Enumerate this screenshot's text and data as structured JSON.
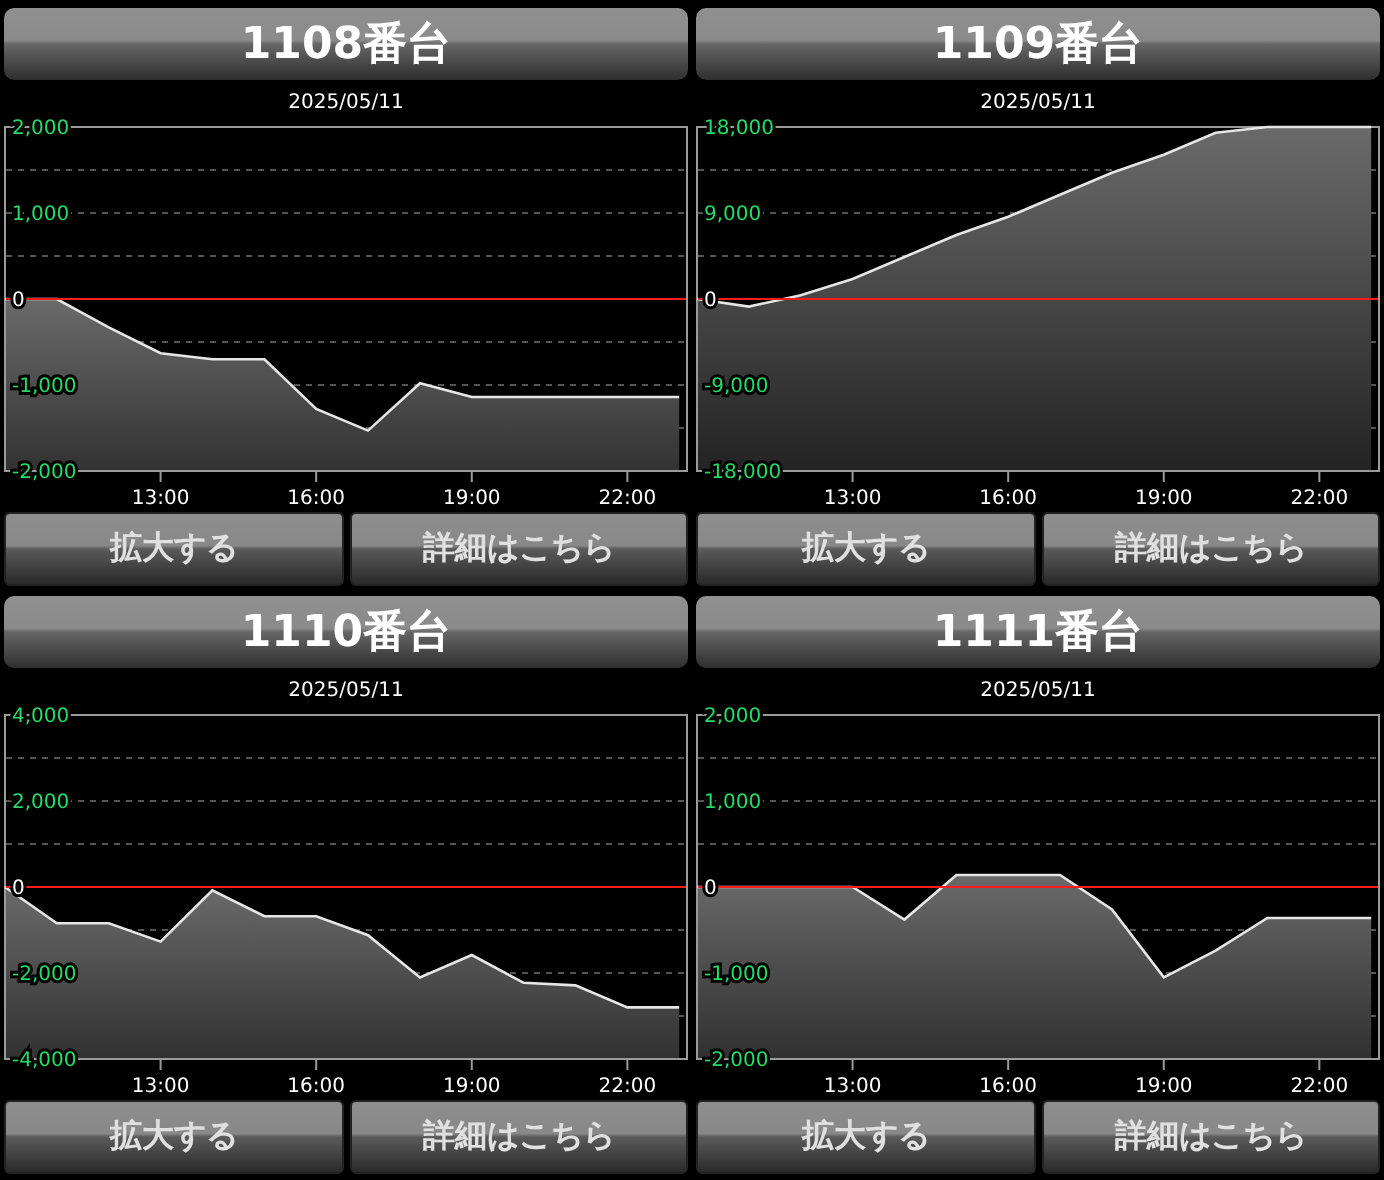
{
  "panels": [
    {
      "title": "1108番台",
      "chart_data": {
        "type": "area",
        "title": "2025/05/11",
        "x": [
          10,
          11,
          12,
          13,
          14,
          15,
          16,
          17,
          18,
          19,
          20,
          21,
          22,
          23
        ],
        "xlim": [
          10,
          23.15
        ],
        "ylim": [
          -2000,
          2000
        ],
        "xticks": [
          {
            "value": 13,
            "label": "13:00"
          },
          {
            "value": 16,
            "label": "16:00"
          },
          {
            "value": 19,
            "label": "19:00"
          },
          {
            "value": 22,
            "label": "22:00"
          }
        ],
        "yticks": [
          {
            "value": 2000,
            "label": "2,000"
          },
          {
            "value": 1000,
            "label": "1,000"
          },
          {
            "value": 0,
            "label": "0"
          },
          {
            "value": -1000,
            "label": "-1,000"
          },
          {
            "value": -2000,
            "label": "-2,000"
          }
        ],
        "ref_lines": [
          {
            "axis": "y",
            "value": 0,
            "color": "#ff1a1a"
          }
        ],
        "series": [
          {
            "color": "#e6e6e6",
            "values": [
              0,
              0,
              -330,
              -630,
              -700,
              -700,
              -1280,
              -1530,
              -980,
              -1140,
              -1140,
              -1140,
              -1140,
              -1140
            ]
          }
        ]
      },
      "buttons": [
        "拡大する",
        "詳細はこちら"
      ]
    },
    {
      "title": "1109番台",
      "chart_data": {
        "type": "area",
        "title": "2025/05/11",
        "x": [
          10,
          11,
          12,
          13,
          14,
          15,
          16,
          17,
          18,
          19,
          20,
          21,
          22,
          23
        ],
        "xlim": [
          10,
          23.15
        ],
        "ylim": [
          -18000,
          18000
        ],
        "xticks": [
          {
            "value": 13,
            "label": "13:00"
          },
          {
            "value": 16,
            "label": "16:00"
          },
          {
            "value": 19,
            "label": "19:00"
          },
          {
            "value": 22,
            "label": "22:00"
          }
        ],
        "yticks": [
          {
            "value": 18000,
            "label": "18,000"
          },
          {
            "value": 9000,
            "label": "9,000"
          },
          {
            "value": 0,
            "label": "0"
          },
          {
            "value": -9000,
            "label": "-9,000"
          },
          {
            "value": -18000,
            "label": "-18,000"
          }
        ],
        "ref_lines": [
          {
            "axis": "y",
            "value": 0,
            "color": "#ff1a1a"
          }
        ],
        "series": [
          {
            "color": "#e6e6e6",
            "values": [
              0,
              -800,
              400,
              2100,
              4400,
              6700,
              8600,
              10900,
              13200,
              15100,
              17400,
              18000,
              18000,
              18000
            ]
          }
        ]
      },
      "buttons": [
        "拡大する",
        "詳細はこちら"
      ]
    },
    {
      "title": "1110番台",
      "chart_data": {
        "type": "area",
        "title": "2025/05/11",
        "x": [
          10,
          11,
          12,
          13,
          14,
          15,
          16,
          17,
          18,
          19,
          20,
          21,
          22,
          23
        ],
        "xlim": [
          10,
          23.15
        ],
        "ylim": [
          -4000,
          4000
        ],
        "xticks": [
          {
            "value": 13,
            "label": "13:00"
          },
          {
            "value": 16,
            "label": "16:00"
          },
          {
            "value": 19,
            "label": "19:00"
          },
          {
            "value": 22,
            "label": "22:00"
          }
        ],
        "yticks": [
          {
            "value": 4000,
            "label": "4,000"
          },
          {
            "value": 2000,
            "label": "2,000"
          },
          {
            "value": 0,
            "label": "0"
          },
          {
            "value": -2000,
            "label": "-2,000"
          },
          {
            "value": -4000,
            "label": "-4,000"
          }
        ],
        "ref_lines": [
          {
            "axis": "y",
            "value": 0,
            "color": "#ff1a1a"
          }
        ],
        "series": [
          {
            "color": "#e6e6e6",
            "values": [
              0,
              -840,
              -840,
              -1270,
              -80,
              -680,
              -680,
              -1120,
              -2100,
              -1580,
              -2230,
              -2290,
              -2800,
              -2800
            ]
          }
        ]
      },
      "buttons": [
        "拡大する",
        "詳細はこちら"
      ]
    },
    {
      "title": "1111番台",
      "chart_data": {
        "type": "area",
        "title": "2025/05/11",
        "x": [
          10,
          11,
          12,
          13,
          14,
          15,
          16,
          17,
          18,
          19,
          20,
          21,
          22,
          23
        ],
        "xlim": [
          10,
          23.15
        ],
        "ylim": [
          -2000,
          2000
        ],
        "xticks": [
          {
            "value": 13,
            "label": "13:00"
          },
          {
            "value": 16,
            "label": "16:00"
          },
          {
            "value": 19,
            "label": "19:00"
          },
          {
            "value": 22,
            "label": "22:00"
          }
        ],
        "yticks": [
          {
            "value": 2000,
            "label": "2,000"
          },
          {
            "value": 1000,
            "label": "1,000"
          },
          {
            "value": 0,
            "label": "0"
          },
          {
            "value": -1000,
            "label": "-1,000"
          },
          {
            "value": -2000,
            "label": "-2,000"
          }
        ],
        "ref_lines": [
          {
            "axis": "y",
            "value": 0,
            "color": "#ff1a1a"
          }
        ],
        "series": [
          {
            "color": "#e6e6e6",
            "values": [
              0,
              0,
              0,
              0,
              -380,
              140,
              140,
              140,
              -260,
              -1050,
              -740,
              -360,
              -360,
              -360
            ]
          }
        ]
      },
      "buttons": [
        "拡大する",
        "詳細はこちら"
      ]
    }
  ]
}
